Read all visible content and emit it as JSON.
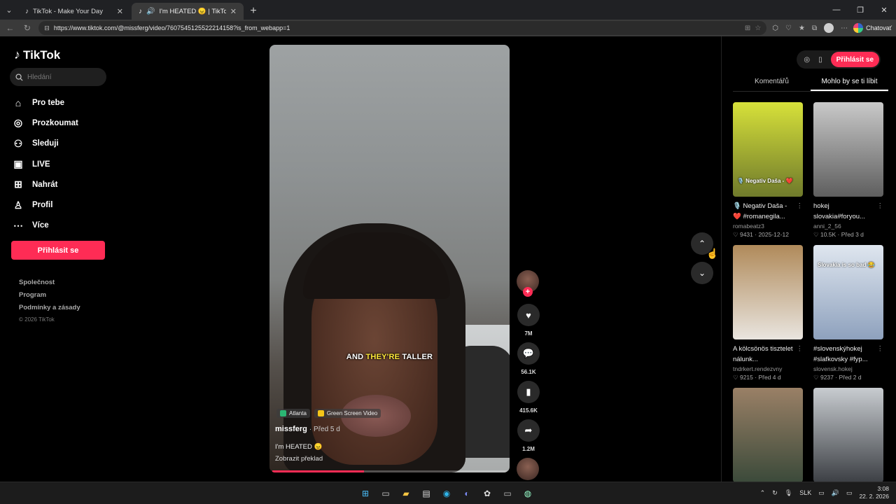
{
  "browser": {
    "tabs": [
      {
        "title": "TikTok - Make Your Day",
        "icon": "tiktok-icon",
        "active": false
      },
      {
        "title": "I'm HEATED 😠 | TikTok",
        "icon": "tiktok-icon",
        "active": true
      }
    ],
    "url": "https://www.tiktok.com/@missferg/video/7607545125522214158?is_from_webapp=1",
    "copilot_label": "Chatovať"
  },
  "sidebar": {
    "logo": "TikTok",
    "search_placeholder": "Hledání",
    "nav": [
      {
        "label": "Pro tebe",
        "icon": "home-icon"
      },
      {
        "label": "Prozkoumat",
        "icon": "compass-icon"
      },
      {
        "label": "Sleduji",
        "icon": "following-icon"
      },
      {
        "label": "LIVE",
        "icon": "live-icon"
      },
      {
        "label": "Nahrát",
        "icon": "upload-icon"
      },
      {
        "label": "Profil",
        "icon": "profile-icon"
      },
      {
        "label": "Více",
        "icon": "more-icon"
      }
    ],
    "login_label": "Přihlásit se",
    "footer": [
      "Společnost",
      "Program",
      "Podmínky a zásady"
    ],
    "copyright": "© 2026 TikTok"
  },
  "video": {
    "caption_parts": [
      "AND",
      "THEY'RE",
      "TALLER"
    ],
    "tags": [
      {
        "label": "Atlanta",
        "color": "#2bb673"
      },
      {
        "label": "Green Screen Video",
        "color": "#f5c518"
      }
    ],
    "author": "missferg",
    "posted": "· Před 5 d",
    "description": "I'm HEATED 😠",
    "translate": "Zobrazit překlad",
    "progress": 0.39
  },
  "actions": {
    "likes": "7M",
    "comments": "56.1K",
    "saves": "415.6K",
    "shares": "1.2M"
  },
  "right_panel": {
    "login_label": "Přihlásit se",
    "tabs": [
      "Komentářů",
      "Mohlo by se ti líbit"
    ],
    "cards": [
      {
        "title": "🎙️ Negativ Daša - ❤️ #romanegila...",
        "user": "romabeatz3",
        "stats": "♡ 9431 · 2025-12-12",
        "thumb_text": "🎙️ Negativ Daša - ❤️",
        "colors": [
          "#d7e13a",
          "#6f7a2b"
        ]
      },
      {
        "title": "hokej slovakia#foryou...",
        "user": "anni_2_56",
        "stats": "♡ 10.5K · Před 3 d",
        "thumb_text": "",
        "colors": [
          "#c9c9c9",
          "#5e5e5e"
        ]
      },
      {
        "title": "A kölcsönös tisztelet nálunk...",
        "user": "tndrkert.rendezvny",
        "stats": "♡ 9215 · Před 4 d",
        "thumb_text": "",
        "colors": [
          "#b08a5a",
          "#e9e5df"
        ]
      },
      {
        "title": "#slovenskýhokej #slafkovsky #fyp...",
        "user": "slovensk.hokej",
        "stats": "♡ 9237 · Před 2 d",
        "thumb_text": "Slovakia is so bad 😂",
        "colors": [
          "#dfe6ef",
          "#8ea1bd"
        ]
      },
      {
        "title": "",
        "user": "",
        "stats": "",
        "thumb_text": "",
        "colors": [
          "#9a8066",
          "#3b4a3a"
        ]
      },
      {
        "title": "",
        "user": "",
        "stats": "",
        "thumb_text": "",
        "colors": [
          "#c8ccd0",
          "#3c3f44"
        ]
      }
    ]
  },
  "taskbar": {
    "language": "SLK",
    "time": "3:08",
    "date": "22. 2. 2026"
  }
}
